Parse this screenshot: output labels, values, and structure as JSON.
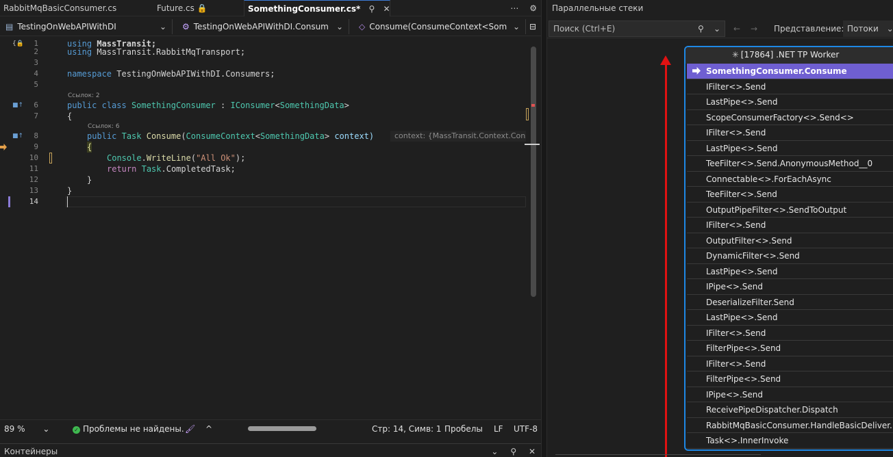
{
  "tabs": [
    {
      "label": "RabbitMqBasicConsumer.cs",
      "active": false
    },
    {
      "label": "Future.cs 🔒",
      "active": false
    },
    {
      "label": "SomethingConsumer.cs*",
      "active": true,
      "pin": "⚲",
      "close": "✕"
    }
  ],
  "tabbar_controls": {
    "overflow": "⋯",
    "settings": "⚙"
  },
  "navbar": {
    "project": "TestingOnWebAPIWithDI",
    "class_scope": "TestingOnWebAPIWithDI.Consum",
    "member_scope": "Consume(ConsumeContext<Som"
  },
  "code": {
    "line_numbers": [
      "1",
      "2",
      "3",
      "4",
      "5",
      "6",
      "7",
      "8",
      "9",
      "10",
      "11",
      "12",
      "13",
      "14"
    ],
    "refs_class": "Ссылок: 2",
    "refs_method": "Ссылок: 6",
    "line1_kw": "using",
    "line1_ns": "MassTransit;",
    "line2_kw": "using",
    "line2_ns": "MassTransit.RabbitMqTransport;",
    "line4_kw": "namespace",
    "line4_ns": "TestingOnWebAPIWithDI.Consumers;",
    "line6_kw1": "public",
    "line6_kw2": "class",
    "line6_name": "SomethingConsumer",
    "line6_colon": " : ",
    "line6_iface": "IConsumer",
    "line6_lt": "<",
    "line6_arg": "SomethingData",
    "line6_gt": ">",
    "line7": "{",
    "line8_kw": "public",
    "line8_type": "Task",
    "line8_fn": "Consume",
    "line8_p1": "(",
    "line8_ptype": "ConsumeContext",
    "line8_lt": "<",
    "line8_parg": "SomethingData",
    "line8_gt": ">",
    "line8_pname": " context)",
    "line8_hint": "context: {MassTransit.Context.Cons",
    "line9": "{",
    "line10_obj": "Console",
    "line10_dot": ".",
    "line10_fn": "WriteLine",
    "line10_p": "(",
    "line10_str": "\"All Ok\"",
    "line10_end": ");",
    "line11_kw": "return",
    "line11_type": "Task",
    "line11_rest": ".CompletedTask;",
    "line12": "}",
    "line13": "}"
  },
  "statusbar": {
    "zoom": "89 %",
    "zoom_chevron": "⌄",
    "issues": "Проблемы не найдены.",
    "brush": "🖌",
    "up": "^",
    "position": "Стр: 14, Симв: 1",
    "whitespace": "Пробелы",
    "eol": "LF",
    "encoding": "UTF-8"
  },
  "bottom_panel": {
    "title": "Контейнеры",
    "dropdown": "⌄",
    "pin": "⚲",
    "close": "✕"
  },
  "stacks": {
    "title": "Параллельные стеки",
    "search_placeholder": "Поиск (Ctrl+E)",
    "search_icon": "⚲",
    "search_drop": "⌄",
    "back": "←",
    "forward": "→",
    "view_label": "Представление:",
    "view_value": "Потоки",
    "view_drop": "⌄",
    "node_header_icon": "✳",
    "node_header": "[17864] .NET TP Worker",
    "frames": [
      "SomethingConsumer.Consume",
      "IFilter<>.Send",
      "LastPipe<>.Send",
      "ScopeConsumerFactory<>.Send<>",
      "IFilter<>.Send",
      "LastPipe<>.Send",
      "TeeFilter<>.Send.AnonymousMethod__0",
      "Connectable<>.ForEachAsync",
      "TeeFilter<>.Send",
      "OutputPipeFilter<>.SendToOutput",
      "IFilter<>.Send",
      "OutputFilter<>.Send",
      "DynamicFilter<>.Send",
      "LastPipe<>.Send",
      "IPipe<>.Send",
      "DeserializeFilter.Send",
      "LastPipe<>.Send",
      "IFilter<>.Send",
      "FilterPipe<>.Send",
      "IFilter<>.Send",
      "FilterPipe<>.Send",
      "IPipe<>.Send",
      "ReceivePipeDispatcher.Dispatch",
      "RabbitMqBasicConsumer.HandleBasicDeliver...",
      "Task<>.InnerInvoke"
    ]
  },
  "colors": {
    "accent": "#1e88e5",
    "current_frame": "#6f5fd1",
    "annotation_arrow": "#e01212"
  }
}
